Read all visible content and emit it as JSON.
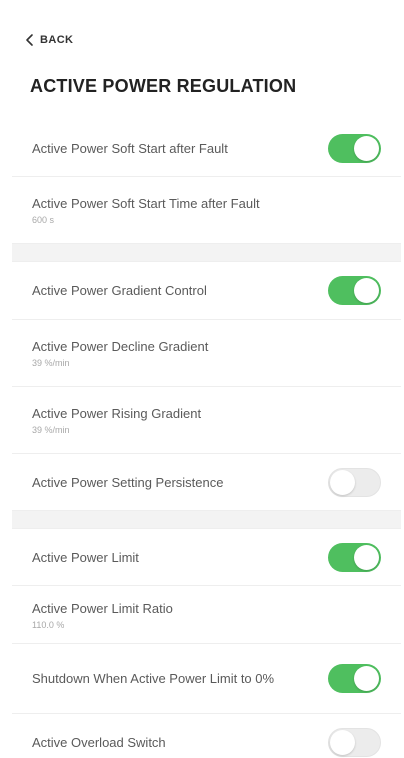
{
  "nav": {
    "back_label": "BACK"
  },
  "page_title": "ACTIVE POWER REGULATION",
  "colors": {
    "accent_green": "#4fbf5f",
    "toggle_off": "#ececec",
    "section_gap": "#f3f3f3"
  },
  "settings": {
    "soft_start": {
      "label": "Active Power Soft Start after Fault",
      "enabled": true
    },
    "soft_start_time": {
      "label": "Active Power Soft Start Time after Fault",
      "value": "600 s"
    },
    "gradient_control": {
      "label": "Active Power Gradient Control",
      "enabled": true
    },
    "decline_gradient": {
      "label": "Active Power Decline Gradient",
      "value": "39 %/min"
    },
    "rising_gradient": {
      "label": "Active Power Rising Gradient",
      "value": "39 %/min"
    },
    "setting_persistence": {
      "label": "Active Power Setting Persistence",
      "enabled": false
    },
    "power_limit": {
      "label": "Active Power Limit",
      "enabled": true
    },
    "limit_ratio": {
      "label": "Active Power Limit Ratio",
      "value": "110.0 %"
    },
    "shutdown_zero": {
      "label": "Shutdown When Active Power Limit to 0%",
      "enabled": true
    },
    "overload_switch": {
      "label": "Active Overload Switch",
      "enabled": false
    }
  }
}
